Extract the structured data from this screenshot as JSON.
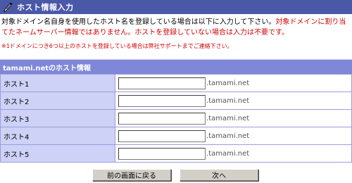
{
  "header": {
    "title": "ホスト情報入力",
    "icon": "pen-icon"
  },
  "description": {
    "line1_black": "対象ドメイン名自身を使用したホスト名を登録している場合は以下に入力して下さい。",
    "line1_red": "対象ドメインに割り当てたネームサーバー情報ではありません。ホストを登録していない場合は入力は不要です。"
  },
  "note": "※1ドメインにつき6つ以上のホストを登録している場合は弊社サポートまでご連絡下さい。",
  "panel": {
    "title": "tamami.netのホスト情報",
    "rows": [
      {
        "label": "ホスト1",
        "value": "",
        "suffix": ".tamami.net"
      },
      {
        "label": "ホスト2",
        "value": "",
        "suffix": ".tamami.net"
      },
      {
        "label": "ホスト3",
        "value": "",
        "suffix": ".tamami.net"
      },
      {
        "label": "ホスト4",
        "value": "",
        "suffix": ".tamami.net"
      },
      {
        "label": "ホスト5",
        "value": "",
        "suffix": ".tamami.net"
      }
    ]
  },
  "buttons": {
    "back": "前の画面に戻る",
    "next": "次へ"
  },
  "colors": {
    "title_bar": "#4a58a8",
    "panel_header": "#7f88d8",
    "label_cell": "#cdd2f6",
    "warning_text": "#d40000"
  }
}
